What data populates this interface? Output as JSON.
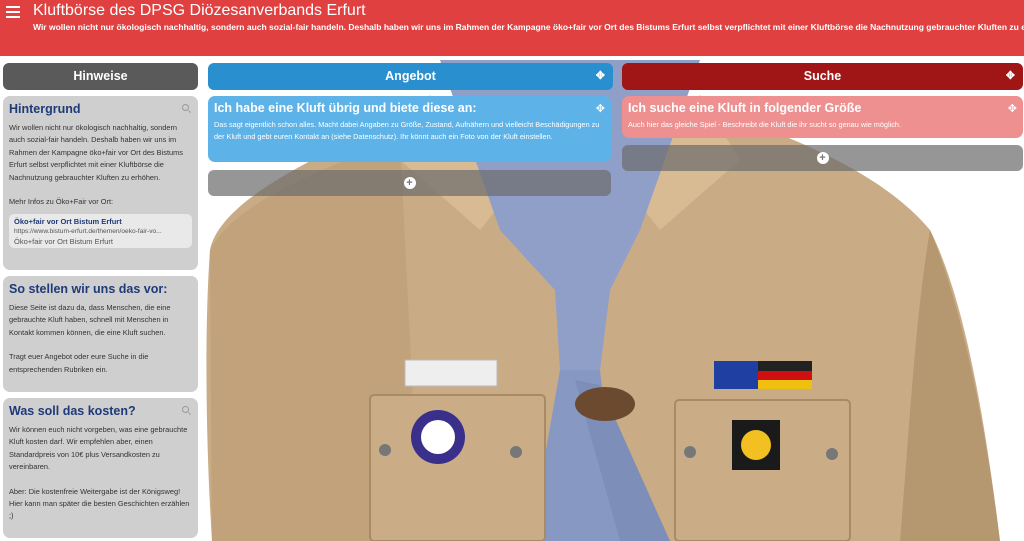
{
  "header": {
    "title": "Kluftbörse des DPSG Diözesanverbands Erfurt",
    "subtitle": "Wir wollen nicht nur ökologisch nachhaltig, sondern auch sozial-fair handeln. Deshalb haben wir uns im Rahmen der Kampagne öko+fair vor Ort des Bistums Erfurt selbst verpflichtet mit einer Kluftbörse die Nachnutzung gebrauchter Kluften zu erhöhen.",
    "menu_icon": "hamburger-icon"
  },
  "colors": {
    "header": "#e04040",
    "hinweise": "#5a5a5a",
    "angebot": "#2a8fcf",
    "suche": "#a01515",
    "angebot_card": "#5db3e8",
    "suche_card": "#ee9090"
  },
  "columns": {
    "hinweise": {
      "label": "Hinweise"
    },
    "angebot": {
      "label": "Angebot",
      "icon": "move-icon"
    },
    "suche": {
      "label": "Suche",
      "icon": "move-icon"
    }
  },
  "hinweise": {
    "hintergrund": {
      "title": "Hintergrund",
      "text": "Wir wollen nicht nur ökologisch nachhaltig, sondern auch sozial-fair handeln. Deshalb haben wir uns im Rahmen der Kampagne öko+fair vor Ort des Bistums Erfurt selbst verpflichtet mit einer Kluftbörse die Nachnutzung gebrauchter Kluften zu erhöhen.",
      "more": "Mehr Infos zu Öko+Fair vor Ort:",
      "link_title": "Öko+fair vor Ort  Bistum Erfurt",
      "link_url": "https://www.bistum-erfurt.de/themen/oeko-fair-vo...",
      "link_img_alt": "Öko+fair vor Ort  Bistum Erfurt"
    },
    "vorstellung": {
      "title": "So stellen wir uns das vor:",
      "text1": "Diese Seite ist dazu da, dass Menschen, die eine gebrauchte Kluft haben, schnell mit Menschen in Kontakt kommen können, die eine Kluft suchen.",
      "text2": "Tragt euer Angebot oder eure Suche in die entsprechenden Rubriken ein."
    },
    "kosten": {
      "title": "Was soll das kosten?",
      "text1": "Wir können euch nicht vorgeben, was eine gebrauchte Kluft kosten darf. Wir empfehlen aber, einen Standardpreis von 10€ plus Versandkosten zu vereinbaren.",
      "text2": "Aber: Die kostenfreie Weitergabe ist der Königsweg! Hier kann man später die besten Geschichten erzählen ;)"
    }
  },
  "angebot": {
    "title": "Ich habe eine Kluft übrig und biete diese an:",
    "text": "Das sagt eigentlich schon alles. Macht dabei Angaben zu Größe, Zustand, Aufnähern und vielleicht Beschädigungen zu der Kluft und gebt euren Kontakt an (siehe Datenschutz). Ihr könnt auch ein Foto von der Kluft einstellen.",
    "add_icon": "plus-icon"
  },
  "suche": {
    "title": "Ich suche eine Kluft in folgender Größe",
    "text": "Auch hier das gleiche Spiel - Beschreibt die Kluft die ihr sucht so genau wie möglich.",
    "add_icon": "plus-icon"
  }
}
